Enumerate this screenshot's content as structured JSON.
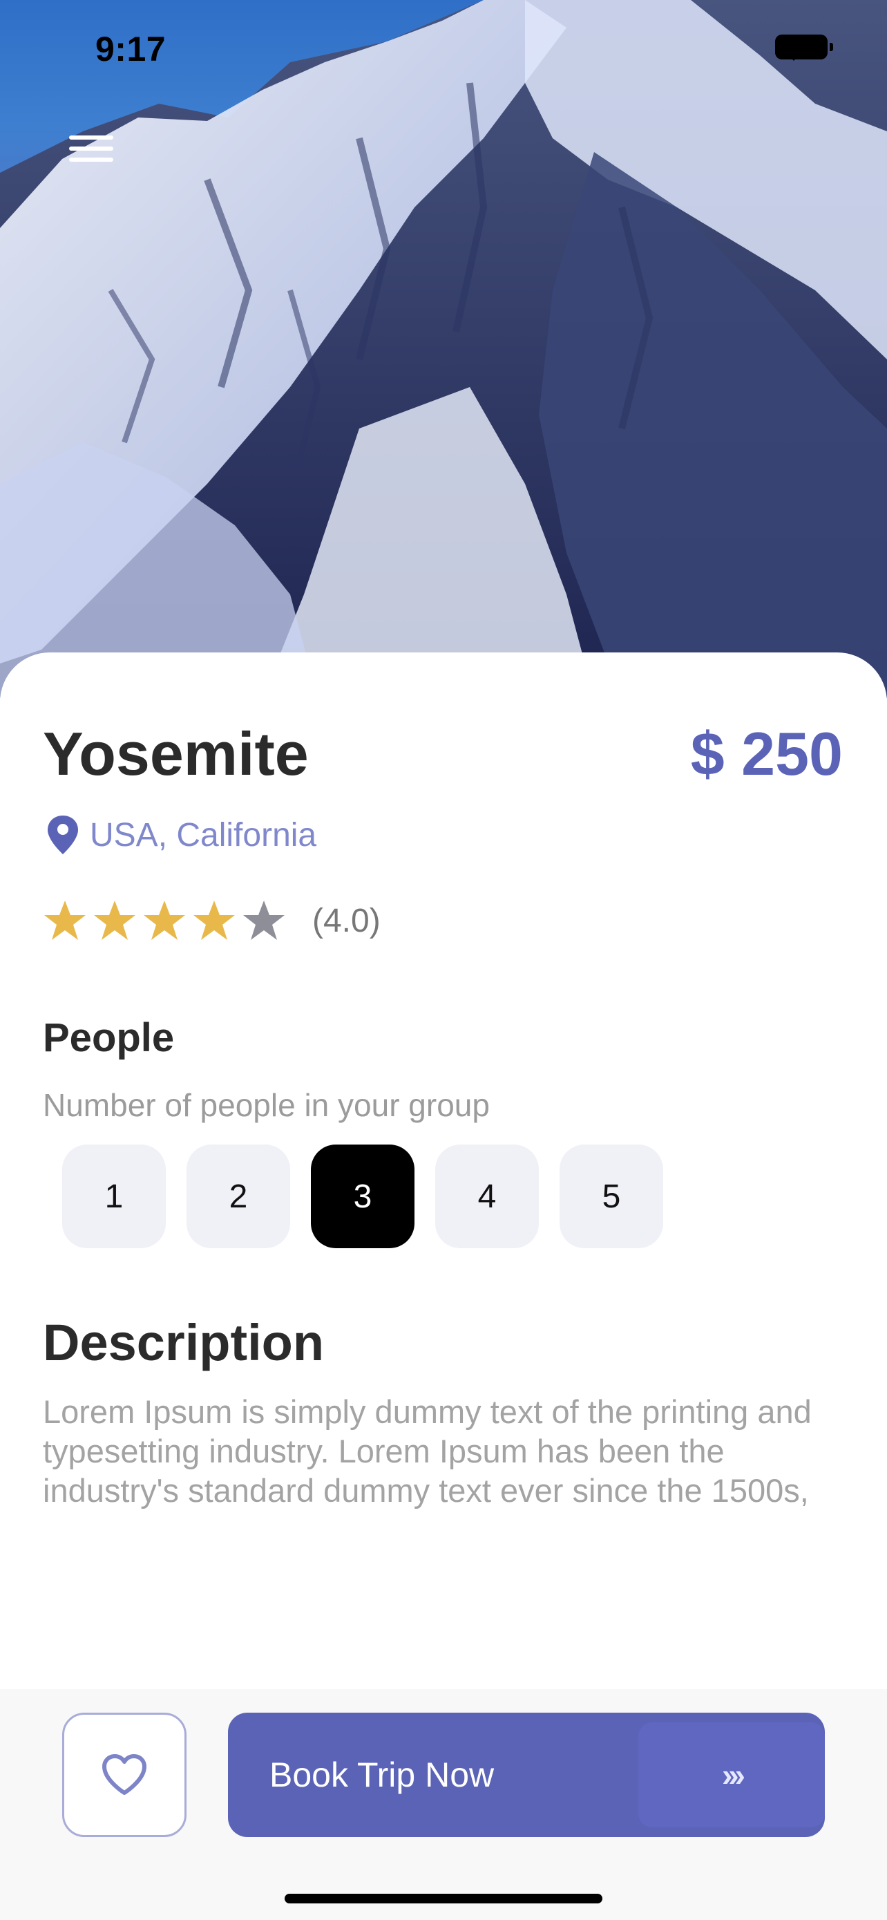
{
  "status_bar": {
    "time": "9:17"
  },
  "hero": {
    "image": "snow-mountain-photo"
  },
  "trip": {
    "title": "Yosemite",
    "price": "$ 250",
    "location": "USA, California",
    "rating_value": 4,
    "rating_max": 5,
    "rating_text": "(4.0)"
  },
  "people": {
    "title": "People",
    "subtitle": "Number of people in your group",
    "options": [
      "1",
      "2",
      "3",
      "4",
      "5"
    ],
    "selected": "3"
  },
  "description": {
    "title": "Description",
    "text": "Lorem Ipsum is simply dummy text of the printing and typesetting industry. Lorem Ipsum has been the industry's standard dummy text ever since the 1500s,"
  },
  "actions": {
    "book_label": "Book Trip Now",
    "arrow_text": "›››"
  },
  "colors": {
    "accent": "#5b63b7",
    "star_filled": "#e8b94a",
    "star_empty": "#8e8e98",
    "selected_chip": "#000000",
    "chip": "#f0f0f7"
  },
  "icons": [
    "menu-icon",
    "wifi-icon",
    "battery-icon",
    "location-pin-icon",
    "star-icon",
    "heart-icon",
    "arrow-right-icon"
  ]
}
